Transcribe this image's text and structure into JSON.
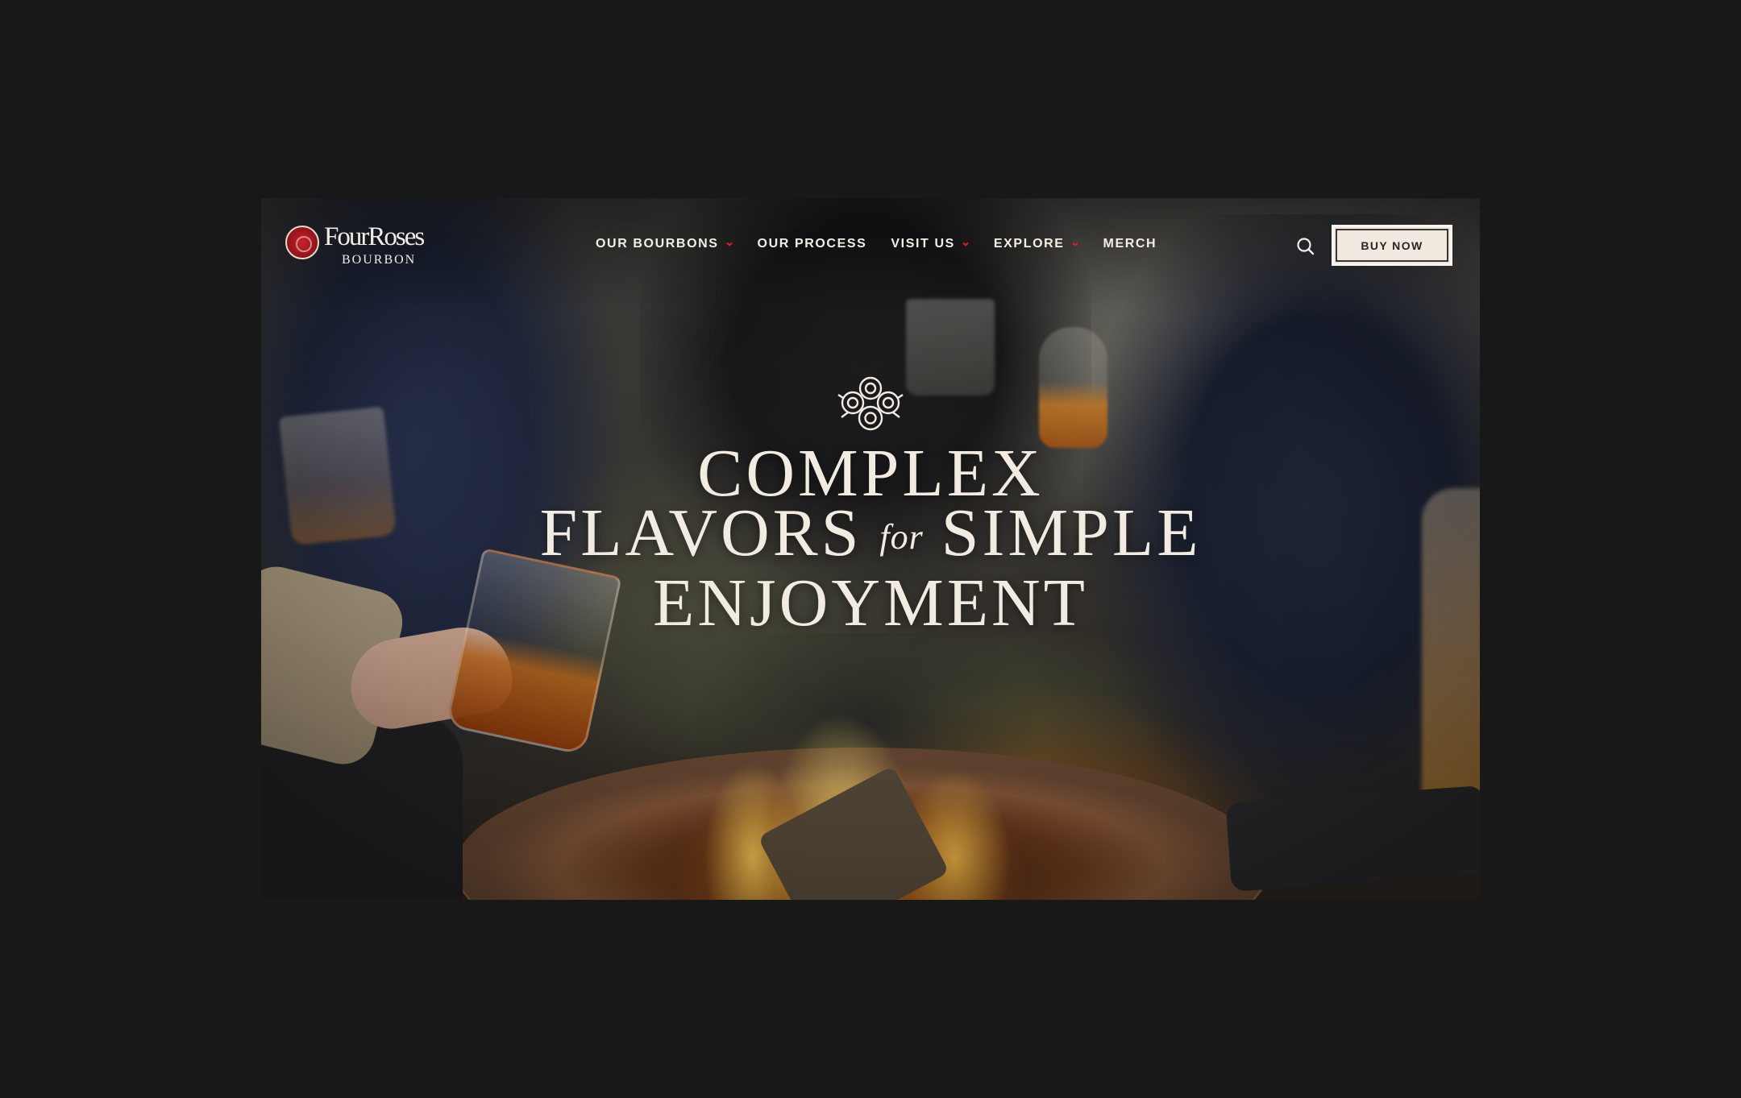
{
  "brand": {
    "name": "FourRoses",
    "sub": "BOURBON",
    "logo_icon": "rose-emblem-icon",
    "accent": "#c8222c"
  },
  "nav": {
    "items": [
      {
        "label": "OUR BOURBONS",
        "has_dropdown": true
      },
      {
        "label": "OUR PROCESS",
        "has_dropdown": false
      },
      {
        "label": "VISIT US",
        "has_dropdown": true
      },
      {
        "label": "EXPLORE",
        "has_dropdown": true
      },
      {
        "label": "MERCH",
        "has_dropdown": false
      }
    ],
    "chevron_color": "#d2232a",
    "search_icon": "search-icon",
    "buy_label": "BUY NOW"
  },
  "hero": {
    "icon": "rose-bouquet-icon",
    "line1": "COMPLEX",
    "line2_a": "FLAVORS",
    "line2_for": "for",
    "line2_b": "SIMPLE",
    "line3": "ENJOYMENT"
  },
  "colors": {
    "page_bg": "#181818",
    "text_light": "#f1ebe2",
    "button_bg": "#efe9df"
  }
}
